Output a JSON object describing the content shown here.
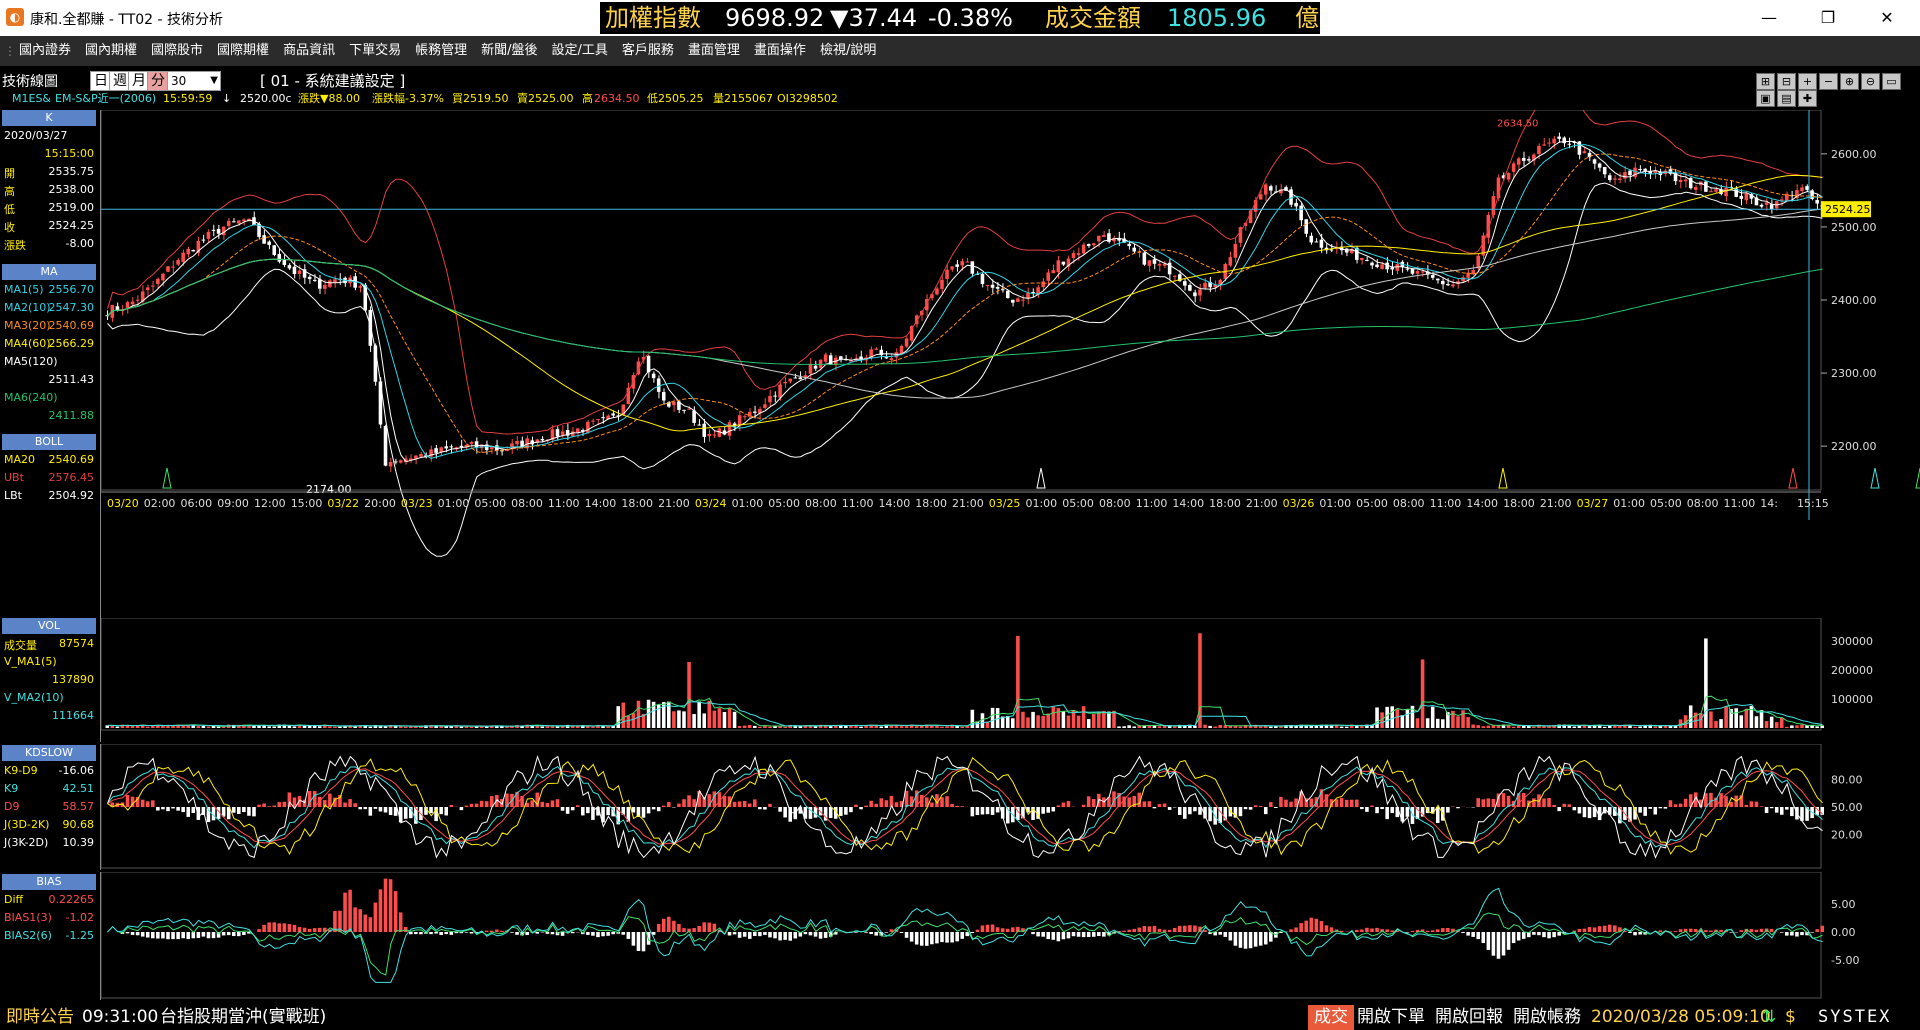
{
  "window": {
    "app_title": "康和.全都賺 - TT02 - 技術分析",
    "minimize": "—",
    "maximize": "❐",
    "close": "✕"
  },
  "ticker": {
    "index_label": "加權指數",
    "index_value": "9698.92",
    "index_change": "▼37.44",
    "index_pct": "-0.38%",
    "amount_label": "成交金額",
    "amount_value": "1805.96",
    "amount_unit": "億"
  },
  "menu": [
    "國內證券",
    "國內期權",
    "國際股市",
    "國際期權",
    "商品資訊",
    "下單交易",
    "帳務管理",
    "新聞/盤後",
    "設定/工具",
    "客戶服務",
    "畫面管理",
    "畫面操作",
    "檢視/說明"
  ],
  "toolbar": {
    "title": "技術線圖",
    "periods": [
      "日",
      "週",
      "月",
      "分"
    ],
    "interval": "30",
    "setting": "[ 01 - 系統建議設定 ]",
    "icons": [
      "plus-box-icon",
      "minus-box-icon",
      "plus-icon",
      "minus-icon",
      "zoom-in-icon",
      "zoom-out-icon",
      "window-icon",
      "save-icon",
      "print-icon",
      "crosshair-icon"
    ]
  },
  "quote": {
    "symbol": "M1ES&",
    "name": "EM-S&P近一(2006)",
    "time": "15:59:59",
    "arrow": "↓",
    "last": "2520.00c",
    "change": "漲跌▼88.00",
    "pct": "漲跌幅-3.37%",
    "bid": "買2519.50",
    "ask": "賣2525.00",
    "high_label": "高",
    "high": "2634.50",
    "low": "低2505.25",
    "vol": "量2155067",
    "oi": "OI3298502"
  },
  "side": {
    "k": {
      "header": "K",
      "date": "2020/03/27",
      "time": "15:15:00",
      "rows": [
        {
          "label": "開",
          "value": "2535.75"
        },
        {
          "label": "高",
          "value": "2538.00"
        },
        {
          "label": "低",
          "value": "2519.00"
        },
        {
          "label": "收",
          "value": "2524.25"
        },
        {
          "label": "漲跌",
          "value": "-8.00"
        }
      ]
    },
    "ma": {
      "header": "MA",
      "rows": [
        {
          "label": "MA1(5)",
          "value": "2556.70"
        },
        {
          "label": "MA2(10)",
          "value": "2547.30"
        },
        {
          "label": "MA3(20)",
          "value": "2540.69"
        },
        {
          "label": "MA4(60)",
          "value": "2566.29"
        },
        {
          "label": "MA5(120)",
          "value": ""
        },
        {
          "label": "",
          "value": "2511.43"
        },
        {
          "label": "MA6(240)",
          "value": ""
        },
        {
          "label": "",
          "value": "2411.88"
        }
      ]
    },
    "boll": {
      "header": "BOLL",
      "rows": [
        {
          "label": "MA20",
          "value": "2540.69"
        },
        {
          "label": "UBt",
          "value": "2576.45"
        },
        {
          "label": "LBt",
          "value": "2504.92"
        }
      ]
    },
    "vol": {
      "header": "VOL",
      "rows": [
        {
          "label": "成交量",
          "value": "87574"
        },
        {
          "label": "V_MA1(5)",
          "value": ""
        },
        {
          "label": "",
          "value": "137890"
        },
        {
          "label": "V_MA2(10)",
          "value": ""
        },
        {
          "label": "",
          "value": "111664"
        }
      ]
    },
    "kd": {
      "header": "KDSLOW",
      "rows": [
        {
          "label": "K9-D9",
          "value": "-16.06"
        },
        {
          "label": "K9",
          "value": "42.51"
        },
        {
          "label": "D9",
          "value": "58.57"
        },
        {
          "label": "J(3D-2K)",
          "value": "90.68"
        },
        {
          "label": "J(3K-2D)",
          "value": "10.39"
        }
      ]
    },
    "bias": {
      "header": "BIAS",
      "rows": [
        {
          "label": "Diff",
          "value": "0.22265"
        },
        {
          "label": "BIAS1(3)",
          "value": "-1.02"
        },
        {
          "label": "BIAS2(6)",
          "value": "-1.25"
        }
      ]
    }
  },
  "chart_data": [
    {
      "type": "candlestick",
      "y_ticks": [
        "2600.00",
        "2500.00",
        "2400.00",
        "2300.00",
        "2200.00"
      ],
      "ylim": [
        2140,
        2660
      ],
      "current_price": "2524.25",
      "high_label": "2634.50",
      "low_label": "2174.00",
      "x_labels": [
        "03/20",
        "02:00",
        "06:00",
        "09:00",
        "12:00",
        "15:00",
        "03/22",
        "20:00",
        "03/23",
        "01:00",
        "05:00",
        "08:00",
        "11:00",
        "14:00",
        "18:00",
        "21:00",
        "03/24",
        "01:00",
        "05:00",
        "08:00",
        "11:00",
        "14:00",
        "18:00",
        "21:00",
        "03/25",
        "01:00",
        "05:00",
        "08:00",
        "11:00",
        "14:00",
        "18:00",
        "21:00",
        "03/26",
        "01:00",
        "05:00",
        "08:00",
        "11:00",
        "14:00",
        "18:00",
        "21:00",
        "03/27",
        "01:00",
        "05:00",
        "08:00",
        "11:00",
        "14:",
        "15:15"
      ],
      "close_path": [
        2385,
        2395,
        2420,
        2455,
        2480,
        2500,
        2510,
        2470,
        2440,
        2420,
        2430,
        2420,
        2178,
        2185,
        2190,
        2198,
        2200,
        2195,
        2205,
        2215,
        2220,
        2230,
        2240,
        2330,
        2260,
        2250,
        2210,
        2230,
        2250,
        2280,
        2300,
        2320,
        2310,
        2330,
        2320,
        2380,
        2430,
        2450,
        2420,
        2400,
        2410,
        2450,
        2470,
        2490,
        2470,
        2450,
        2440,
        2410,
        2430,
        2500,
        2560,
        2540,
        2480,
        2470,
        2460,
        2450,
        2440,
        2430,
        2420,
        2440,
        2560,
        2590,
        2610,
        2620,
        2590,
        2560,
        2580,
        2575,
        2560,
        2555,
        2550,
        2535,
        2530,
        2555,
        2524
      ]
    },
    {
      "type": "bar",
      "name": "VOL",
      "y_ticks": [
        "300000",
        "200000",
        "100000"
      ],
      "ylim": [
        0,
        380000
      ]
    },
    {
      "type": "line",
      "name": "KDSLOW",
      "y_ticks": [
        "80.00",
        "50.00",
        "20.00"
      ],
      "ylim": [
        -10,
        110
      ]
    },
    {
      "type": "bar",
      "name": "BIAS",
      "y_ticks": [
        "5.00",
        "0.00",
        "-5.00"
      ],
      "ylim": [
        -10,
        10
      ]
    }
  ],
  "statusbar": {
    "notice": "即時公告",
    "time": "09:31:00",
    "message": "台指股期當沖(實戰班)",
    "btn_trade": "成交",
    "btn_order": "開啟下單",
    "btn_report": "開啟回報",
    "btn_account": "開啟帳務",
    "datetime": "2020/03/28 05:09:10",
    "brand": "SYSTEX"
  },
  "colors": {
    "up": "#ff4d4d",
    "down": "#ffffff",
    "ma5": "#ffffff",
    "ma10": "#2fd3e6",
    "ma20": "#ff8c1a",
    "ma60": "#ffee00",
    "ma120": "#c8c8c8",
    "ma240": "#22c26a",
    "upper": "#e04040",
    "lower": "#ffffff"
  }
}
